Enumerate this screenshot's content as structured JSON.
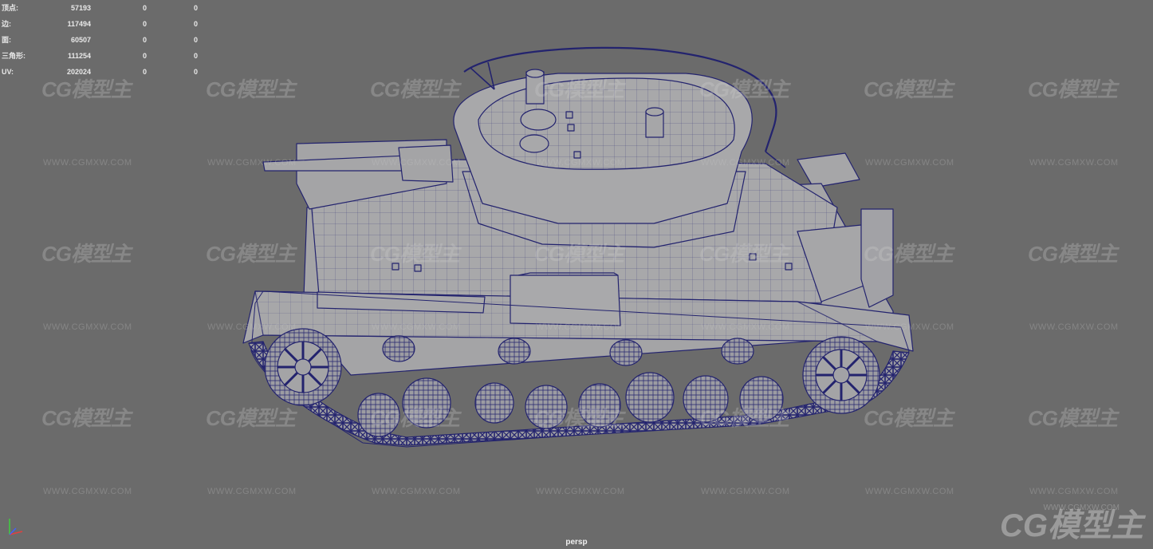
{
  "viewport": {
    "camera": "persp",
    "background": "#6b6b6b",
    "wire_color": "#23236e",
    "mesh_color": "#a4a4a6"
  },
  "hud": {
    "rows": [
      {
        "label": "顶点:",
        "v1": "57193",
        "v2": "0",
        "v3": "0"
      },
      {
        "label": "边:",
        "v1": "117494",
        "v2": "0",
        "v3": "0"
      },
      {
        "label": "面:",
        "v1": "60507",
        "v2": "0",
        "v3": "0"
      },
      {
        "label": "三角形:",
        "v1": "111254",
        "v2": "0",
        "v3": "0"
      },
      {
        "label": "UV:",
        "v1": "202024",
        "v2": "0",
        "v3": "0"
      }
    ]
  },
  "watermark": {
    "logo": "CG模型主",
    "url": "WWW.CGMXW.COM"
  },
  "axis": {
    "x_color": "#e04040",
    "y_color": "#40d040",
    "z_color": "#4060ff"
  }
}
